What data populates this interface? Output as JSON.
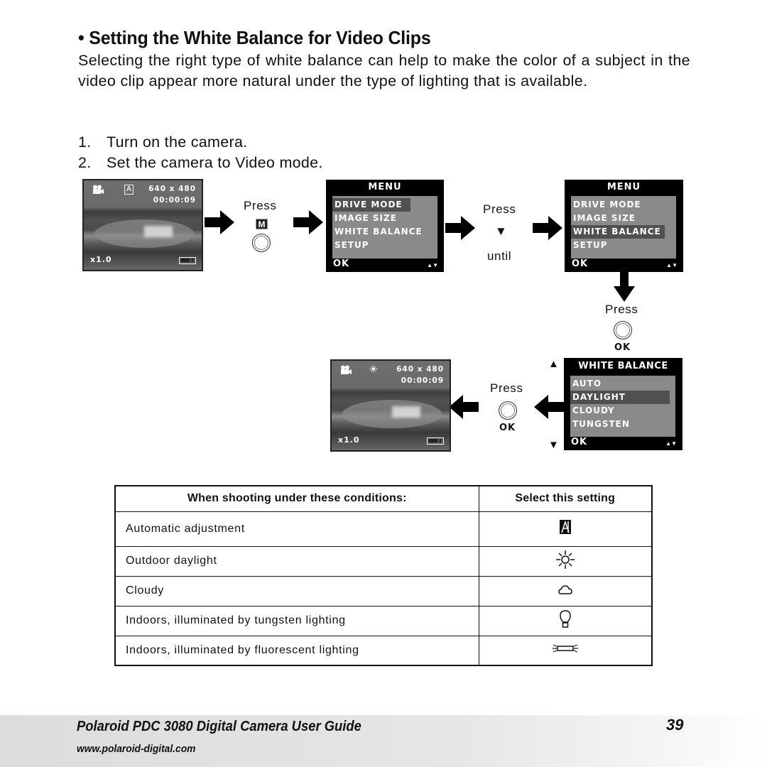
{
  "heading": "• Setting the White Balance for Video Clips",
  "intro": "Selecting the right type of white balance can help to make the color of a subject in the video clip appear more natural under the type of lighting that is available.",
  "steps": [
    {
      "num": "1.",
      "text": "Turn on the camera."
    },
    {
      "num": "2.",
      "text": "Set the camera to Video mode."
    }
  ],
  "liveview_1": {
    "resolution": "640 x 480",
    "time": "00:00:09",
    "zoom": "x1.0",
    "mode_icon": "video-camera-icon",
    "wb_icon": "auto-wb-icon",
    "wb_glyph": "A"
  },
  "liveview_2": {
    "resolution": "640 x 480",
    "time": "00:00:09",
    "zoom": "x1.0",
    "mode_icon": "video-camera-icon",
    "wb_icon": "daylight-icon",
    "wb_glyph": "☀"
  },
  "instructions": {
    "press": "Press",
    "until": "until",
    "m_button": "M",
    "ok_label": "OK",
    "down_arrow": "▼"
  },
  "menu_1": {
    "title": "MENU",
    "items": [
      "DRIVE MODE",
      "IMAGE SIZE",
      "WHITE BALANCE",
      "SETUP"
    ],
    "selected": "DRIVE MODE",
    "ok": "OK",
    "nav": "▲▼"
  },
  "menu_2": {
    "title": "MENU",
    "items": [
      "DRIVE MODE",
      "IMAGE SIZE",
      "WHITE BALANCE",
      "SETUP"
    ],
    "selected": "WHITE BALANCE",
    "ok": "OK",
    "nav": "▲▼"
  },
  "wb_menu": {
    "title": "WHITE BALANCE",
    "items": [
      "AUTO",
      "DAYLIGHT",
      "CLOUDY",
      "TUNGSTEN"
    ],
    "selected": "DAYLIGHT",
    "ok": "OK",
    "nav": "▲▼",
    "scroll_up": "▲",
    "scroll_down": "▼"
  },
  "table": {
    "headers": [
      "When shooting under these conditions:",
      "Select this setting"
    ],
    "rows": [
      {
        "condition": "Automatic adjustment",
        "icon": "auto-wb-icon"
      },
      {
        "condition": "Outdoor daylight",
        "icon": "sun-icon"
      },
      {
        "condition": "Cloudy",
        "icon": "cloud-icon"
      },
      {
        "condition": "Indoors, illuminated by tungsten lighting",
        "icon": "light-bulb-icon"
      },
      {
        "condition": "Indoors, illuminated by fluorescent lighting",
        "icon": "fluorescent-tube-icon"
      }
    ]
  },
  "footer": {
    "title": "Polaroid PDC 3080 Digital Camera User Guide",
    "url": "www.polaroid-digital.com",
    "page": "39"
  }
}
